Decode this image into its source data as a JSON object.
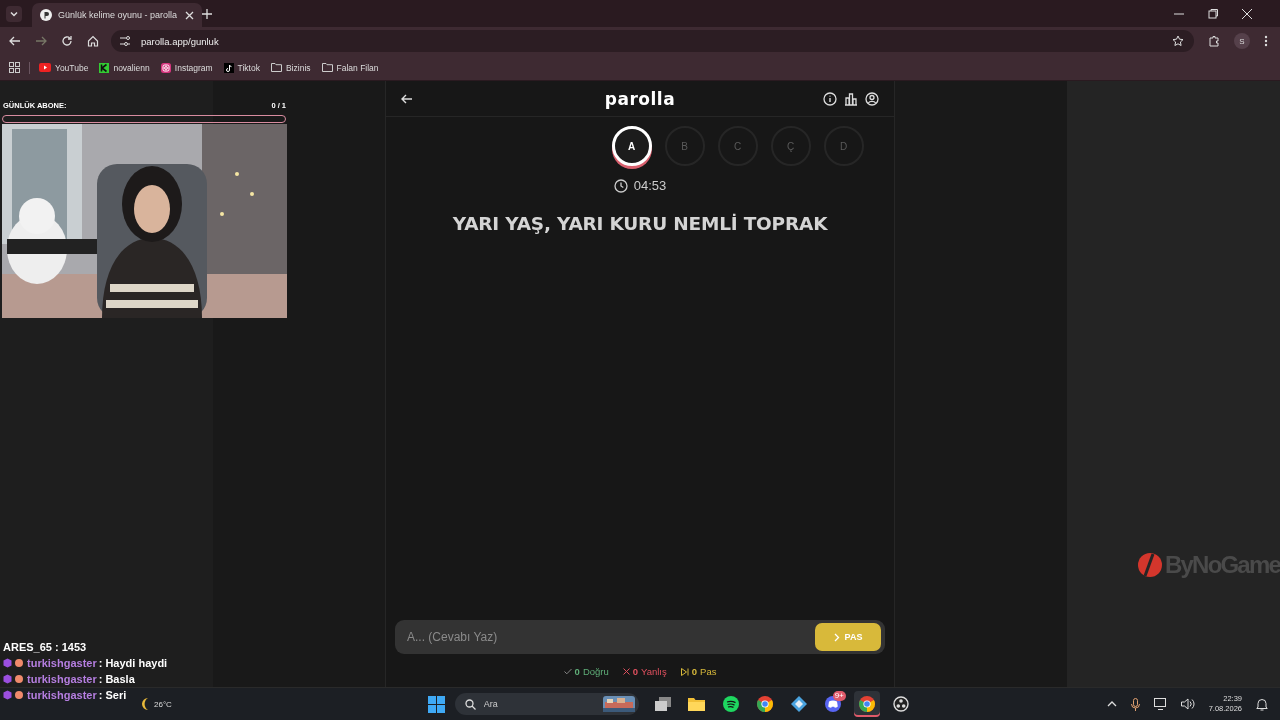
{
  "browser": {
    "tabs": [
      {
        "title": "Günlük kelime oyunu - parolla",
        "selected": true
      }
    ],
    "url": "parolla.app/gunluk",
    "profile": "S",
    "bookmarks": [
      {
        "label": "YouTube",
        "kind": "youtube"
      },
      {
        "label": "novalienn",
        "kind": "k"
      },
      {
        "label": "Instagram",
        "kind": "instagram"
      },
      {
        "label": "Tiktok",
        "kind": "tiktok"
      },
      {
        "label": "Bizinis",
        "kind": "folder"
      },
      {
        "label": "Falan Filan",
        "kind": "folder"
      }
    ]
  },
  "overlay": {
    "goal": {
      "label": "GÜNLÜK ABONE:",
      "count": "0 / 1",
      "level": 0
    },
    "chat_top": "ARES_65 : 1453",
    "chat": [
      {
        "user": "turkishgaster",
        "text": ": Haydi haydi"
      },
      {
        "user": "turkishgaster",
        "text": ": Basla"
      },
      {
        "user": "turkishgaster",
        "text": ": Seri"
      }
    ],
    "sponsor": "ByNoGame"
  },
  "game": {
    "title": "parolla",
    "letters": [
      {
        "letter": "A",
        "selected": true
      },
      {
        "letter": "B",
        "selected": false
      },
      {
        "letter": "C",
        "selected": false
      },
      {
        "letter": "Ç",
        "selected": false
      },
      {
        "letter": "D",
        "selected": false
      }
    ],
    "timer": "04:53",
    "clue": "YARI YAŞ, YARI KURU NEMLİ TOPRAK",
    "answer": {
      "placeholder": "A... (Cevabı Yaz)"
    },
    "pass_button": "PAS",
    "stats": [
      {
        "kind": "correct",
        "count": "0",
        "label": "Doğru"
      },
      {
        "kind": "wrong",
        "count": "0",
        "label": "Yanlış"
      },
      {
        "kind": "pass",
        "count": "0",
        "label": "Pas"
      }
    ]
  },
  "taskbar": {
    "weather": "26°C",
    "search": {
      "placeholder": "Ara"
    },
    "apps": [
      {
        "kind": "taskview",
        "active": false
      },
      {
        "kind": "folder",
        "active": false
      },
      {
        "kind": "spotify",
        "active": false
      },
      {
        "kind": "chrome",
        "active": false
      },
      {
        "kind": "gem",
        "active": false
      },
      {
        "kind": "discord",
        "active": false,
        "badge": "9+"
      },
      {
        "kind": "chrome",
        "active": true
      },
      {
        "kind": "obs",
        "active": false
      }
    ],
    "time": "22:39",
    "date": "7.08.2026"
  }
}
